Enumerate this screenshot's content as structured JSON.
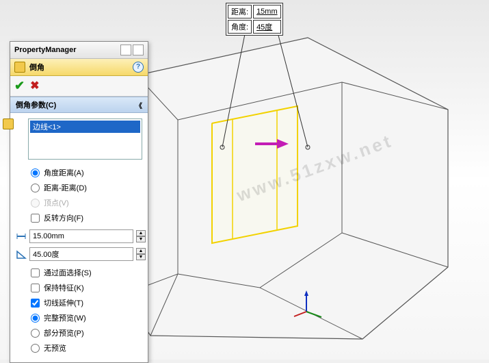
{
  "pm": {
    "title": "PropertyManager",
    "feature": "倒角",
    "ok": "✔",
    "cancel": "✖",
    "help": "?"
  },
  "group": {
    "title": "倒角参数(C)",
    "collapse": "《"
  },
  "selection": {
    "item": "边线<1>"
  },
  "options": {
    "angle_dist": "角度距离(A)",
    "dist_dist": "距离-距离(D)",
    "vertex": "顶点(V)",
    "flip": "反转方向(F)",
    "distance_value": "15.00mm",
    "angle_value": "45.00度",
    "through_face": "通过面选择(S)",
    "keep_feature": "保持特征(K)",
    "tangent_prop": "切线延伸(T)",
    "full_preview": "完整预览(W)",
    "partial_preview": "部分预览(P)",
    "no_preview": "无预览"
  },
  "callout": {
    "distance_label": "距离:",
    "distance_val": "15mm",
    "angle_label": "角度:",
    "angle_val": "45度"
  },
  "watermark": "www.51zxw.net"
}
